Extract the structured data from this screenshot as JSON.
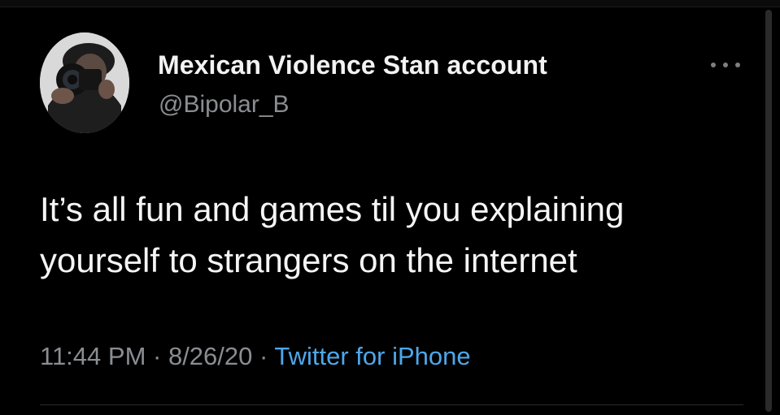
{
  "tweet": {
    "display_name": "Mexican Violence Stan account",
    "handle": "@Bipolar_B",
    "text": "It’s all fun and games til you explaining yourself to strangers on the internet",
    "time": "11:44 PM",
    "separator1": " · ",
    "date": "8/26/20",
    "separator2": " · ",
    "source": "Twitter for iPhone",
    "more_icon": "more-horizontal-icon",
    "avatar_icon": "profile-photo"
  },
  "colors": {
    "background": "#000000",
    "primary_text": "#f5f5f5",
    "secondary_text": "#8a8d91",
    "link": "#4ea7ea"
  }
}
